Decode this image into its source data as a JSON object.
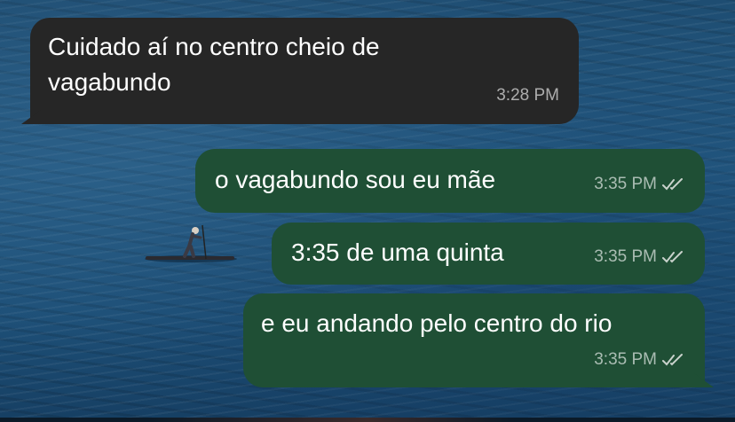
{
  "messages": [
    {
      "direction": "incoming",
      "text": "Cuidado aí no centro cheio de vagabundo",
      "time": "3:28 PM"
    },
    {
      "direction": "outgoing",
      "text": "o vagabundo sou eu mãe",
      "time": "3:35 PM",
      "status": "read"
    },
    {
      "direction": "outgoing",
      "text": "3:35 de uma quinta",
      "time": "3:35 PM",
      "status": "read"
    },
    {
      "direction": "outgoing",
      "text": "e eu andando pelo centro do rio",
      "time": "3:35 PM",
      "status": "read"
    }
  ],
  "colors": {
    "incoming_bubble": "#262626",
    "outgoing_bubble": "#1f4f35",
    "read_ticks": "#c9d2cc"
  },
  "icons": {
    "status": "double-check-icon",
    "wallpaper": "ocean-paddleboarder-photo"
  }
}
